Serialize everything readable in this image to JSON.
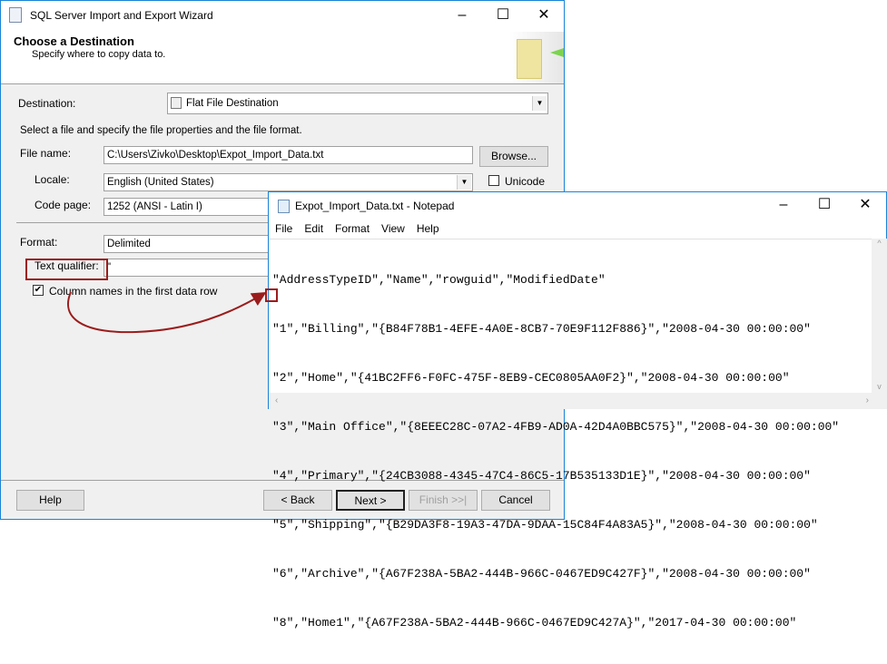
{
  "wizard": {
    "title": "SQL Server Import and Export Wizard",
    "header_title": "Choose a Destination",
    "header_subtitle": "Specify where to copy data to.",
    "destination_label": "Destination:",
    "destination_value": "Flat File Destination",
    "instruction": "Select a file and specify the file properties and the file format.",
    "file_name_label": "File name:",
    "file_name_value": "C:\\Users\\Zivko\\Desktop\\Expot_Import_Data.txt",
    "browse_label": "Browse...",
    "locale_label": "Locale:",
    "locale_value": "English (United States)",
    "unicode_label": "Unicode",
    "code_page_label": "Code page:",
    "code_page_value": "1252  (ANSI - Latin I)",
    "format_label": "Format:",
    "format_value": "Delimited",
    "text_qualifier_label": "Text qualifier:",
    "text_qualifier_value": "\"",
    "column_names_label": "Column names in the first data row",
    "buttons": {
      "help": "Help",
      "back": "< Back",
      "next": "Next >",
      "finish": "Finish >>|",
      "cancel": "Cancel"
    }
  },
  "notepad": {
    "title": "Expot_Import_Data.txt - Notepad",
    "menu": [
      "File",
      "Edit",
      "Format",
      "View",
      "Help"
    ],
    "lines": [
      "\"AddressTypeID\",\"Name\",\"rowguid\",\"ModifiedDate\"",
      "\"1\",\"Billing\",\"{B84F78B1-4EFE-4A0E-8CB7-70E9F112F886}\",\"2008-04-30 00:00:00\"",
      "\"2\",\"Home\",\"{41BC2FF6-F0FC-475F-8EB9-CEC0805AA0F2}\",\"2008-04-30 00:00:00\"",
      "\"3\",\"Main Office\",\"{8EEEC28C-07A2-4FB9-AD0A-42D4A0BBC575}\",\"2008-04-30 00:00:00\"",
      "\"4\",\"Primary\",\"{24CB3088-4345-47C4-86C5-17B535133D1E}\",\"2008-04-30 00:00:00\"",
      "\"5\",\"Shipping\",\"{B29DA3F8-19A3-47DA-9DAA-15C84F4A83A5}\",\"2008-04-30 00:00:00\"",
      "\"6\",\"Archive\",\"{A67F238A-5BA2-444B-966C-0467ED9C427F}\",\"2008-04-30 00:00:00\"",
      "\"8\",\"Home1\",\"{A67F238A-5BA2-444B-966C-0467ED9C427A}\",\"2017-04-30 00:00:00\""
    ]
  },
  "colors": {
    "annotation": "#9b1c1c",
    "border": "#1883d7"
  }
}
